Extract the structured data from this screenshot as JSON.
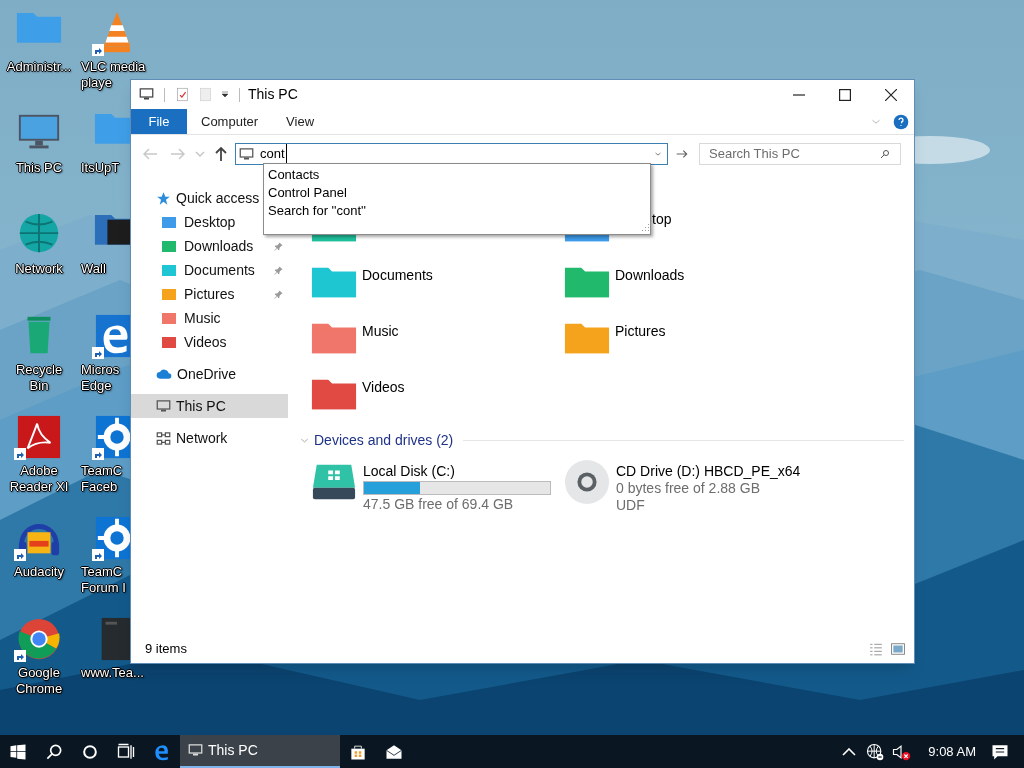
{
  "desktop_columns": [
    [
      {
        "lines": [
          "Administr..."
        ],
        "kind": "folder",
        "shortcut": false
      },
      {
        "lines": [
          "This PC"
        ],
        "kind": "monitor",
        "shortcut": false
      },
      {
        "lines": [
          "Network"
        ],
        "kind": "globe",
        "shortcut": false
      },
      {
        "lines": [
          "Recycle",
          "Bin"
        ],
        "kind": "bin",
        "shortcut": false
      },
      {
        "lines": [
          "Adobe",
          "Reader XI"
        ],
        "kind": "pdf",
        "shortcut": true
      },
      {
        "lines": [
          "Audacity"
        ],
        "kind": "audio",
        "shortcut": true
      },
      {
        "lines": [
          "Google",
          "Chrome"
        ],
        "kind": "chrome",
        "shortcut": true
      }
    ],
    [
      {
        "lines": [
          "VLC media",
          "playe"
        ],
        "kind": "cone",
        "shortcut": true
      },
      {
        "lines": [
          "ItsUpT"
        ],
        "kind": "folder",
        "shortcut": false
      },
      {
        "lines": [
          "Wall"
        ],
        "kind": "darkfolder",
        "shortcut": false
      },
      {
        "lines": [
          "Micros",
          "Edge"
        ],
        "kind": "edge",
        "shortcut": true
      },
      {
        "lines": [
          "TeamC",
          "Faceb"
        ],
        "kind": "gear",
        "shortcut": true
      },
      {
        "lines": [
          "TeamC",
          "Forum I"
        ],
        "kind": "gear",
        "shortcut": true
      },
      {
        "lines": [
          "www.Tea..."
        ],
        "kind": "book",
        "shortcut": false
      }
    ]
  ],
  "window": {
    "title": "This PC",
    "ribbon_tabs": [
      {
        "label": "File",
        "kind": "file",
        "selected": false
      },
      {
        "label": "Computer",
        "kind": "tab",
        "selected": false
      },
      {
        "label": "View",
        "kind": "tab",
        "selected": false
      }
    ],
    "nav_buttons": [
      {
        "kind": "back",
        "disabled": true
      },
      {
        "kind": "forward",
        "disabled": true
      },
      {
        "kind": "recent",
        "disabled": true
      },
      {
        "kind": "up",
        "disabled": false
      }
    ],
    "address": {
      "value": "cont"
    },
    "autocomplete": [
      "Contacts",
      "Control Panel",
      "Search for ''cont''"
    ],
    "search": {
      "placeholder": "Search This PC"
    },
    "nav": [
      {
        "label": "Quick access",
        "kind": "star",
        "selected": false,
        "children": [
          {
            "label": "Desktop",
            "kind": "folder",
            "color": "#3d9be9",
            "selected": false
          },
          {
            "label": "Downloads",
            "kind": "folder",
            "color": "#21b96b",
            "pinned": true,
            "selected": false
          },
          {
            "label": "Documents",
            "kind": "folder",
            "color": "#1ec5d2",
            "pinned": true,
            "selected": false
          },
          {
            "label": "Pictures",
            "kind": "folder",
            "color": "#f5a31d",
            "pinned": true,
            "selected": false
          },
          {
            "label": "Music",
            "kind": "folder",
            "color": "#f0766a",
            "pinned": false,
            "selected": false
          },
          {
            "label": "Videos",
            "kind": "folder",
            "color": "#e04a43",
            "pinned": false,
            "selected": false
          }
        ]
      },
      {
        "label": "OneDrive",
        "kind": "cloud",
        "selected": false
      },
      {
        "label": "This PC",
        "kind": "monitor",
        "selected": true
      },
      {
        "label": "Network",
        "kind": "network",
        "selected": false
      }
    ],
    "folders": [
      {
        "color": "#1fbf9c"
      },
      {
        "label": "top",
        "color": "#3d9be9"
      },
      {
        "label": "Documents",
        "color": "#1ec5d2"
      },
      {
        "label": "Downloads",
        "color": "#21b96b"
      },
      {
        "label": "Music",
        "color": "#f0766a"
      },
      {
        "label": "Pictures",
        "color": "#f5a31d"
      },
      {
        "label": "Videos",
        "color": "#e04a43"
      }
    ],
    "devices_header": "Devices and drives (2)",
    "drives": [
      {
        "name": "Local Disk (C:)",
        "kind": "disk",
        "level": 0.3,
        "detail": "47.5 GB free of 69.4 GB"
      },
      {
        "name": "CD Drive (D:) HBCD_PE_x64",
        "kind": "cd",
        "detail": "0 bytes free of 2.88 GB",
        "filesystem": "UDF"
      }
    ],
    "status_bar": {
      "item_count": "9 items"
    }
  },
  "taskbar": {
    "items": [
      {
        "kind": "start"
      },
      {
        "kind": "search"
      },
      {
        "kind": "cortana"
      },
      {
        "kind": "taskview"
      },
      {
        "kind": "edge"
      },
      {
        "kind": "window",
        "label": "This PC",
        "selected": true
      },
      {
        "kind": "store"
      },
      {
        "kind": "mail"
      }
    ],
    "tray": [
      {
        "kind": "chevron"
      },
      {
        "kind": "globe"
      },
      {
        "kind": "muted"
      }
    ],
    "clock": "9:08 AM"
  }
}
